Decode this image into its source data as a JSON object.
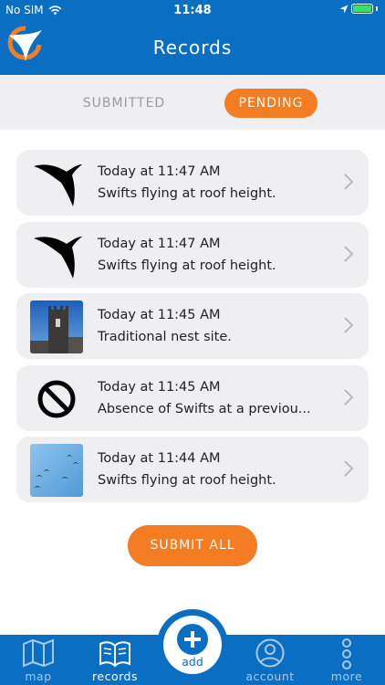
{
  "status_bar": {
    "carrier": "No SIM",
    "time": "11:48"
  },
  "header": {
    "title": "Records"
  },
  "segments": {
    "submitted_label": "SUBMITTED",
    "pending_label": "PENDING",
    "active": "pending"
  },
  "records": [
    {
      "time": "Today at 11:47 AM",
      "description": "Swifts flying at roof height.",
      "thumbnail": "swift-silhouette-icon"
    },
    {
      "time": "Today at 11:47 AM",
      "description": "Swifts flying at roof height.",
      "thumbnail": "swift-silhouette-icon"
    },
    {
      "time": "Today at 11:45 AM",
      "description": "Traditional nest site.",
      "thumbnail": "church-tower-photo"
    },
    {
      "time": "Today at 11:45 AM",
      "description": "Absence of Swifts at a previou...",
      "thumbnail": "prohibited-icon"
    },
    {
      "time": "Today at 11:44 AM",
      "description": "Swifts flying at roof height.",
      "thumbnail": "swifts-in-sky-photo"
    }
  ],
  "submit_all_label": "SUBMIT ALL",
  "tabbar": {
    "map_label": "map",
    "records_label": "records",
    "add_label": "add",
    "account_label": "account",
    "more_label": "more",
    "active": "records"
  },
  "colors": {
    "brand_blue": "#0a6fc2",
    "accent_orange": "#f47d23",
    "card_gray": "#efeff2",
    "battery_green": "#3be06a"
  }
}
